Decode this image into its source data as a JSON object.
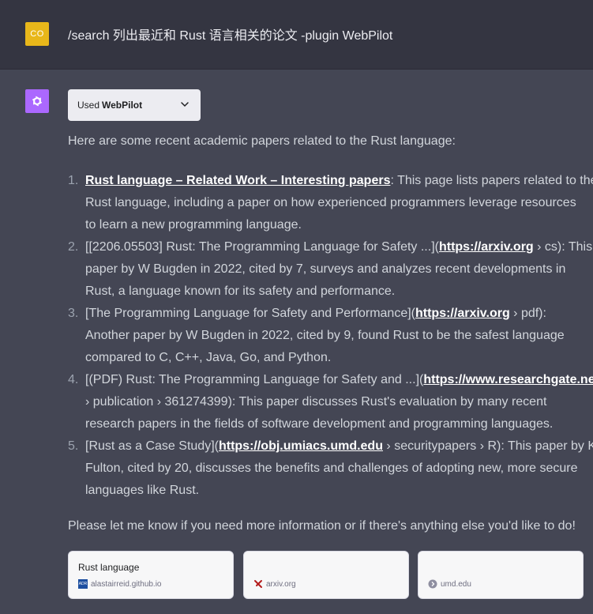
{
  "user_message": {
    "avatar_initials": "CO",
    "text": "/search 列出最近和 Rust 语言相关的论文 -plugin WebPilot"
  },
  "assistant": {
    "plugin_chip": {
      "used_label": "Used",
      "plugin_name": "WebPilot"
    },
    "intro": "Here are some recent academic papers related to the Rust language:",
    "items": [
      {
        "number": "1.",
        "link": "Rust language – Related Work – Interesting papers",
        "l1_after": ": This page lists papers related to the",
        "l2": "Rust language, including a paper on how experienced programmers leverage resources",
        "l3": "to learn a new programming language."
      },
      {
        "number": "2.",
        "l1_before": "[[2206.05503] Rust: The Programming Language for Safety ...](",
        "link": "https://arxiv.org",
        "l1_after": " › cs): This",
        "l2": "paper by W Bugden in 2022, cited by 7, surveys and analyzes recent developments in",
        "l3": "Rust, a language known for its safety and performance."
      },
      {
        "number": "3.",
        "l1_before": "[The Programming Language for Safety and Performance](",
        "link": "https://arxiv.org",
        "l1_after": " › pdf):",
        "l2": "Another paper by W Bugden in 2022, cited by 9, found Rust to be the safest language",
        "l3": "compared to C, C++, Java, Go, and Python."
      },
      {
        "number": "4.",
        "l1_before": "[(PDF) Rust: The Programming Language for Safety and ...](",
        "link": "https://www.researchgate.net",
        "l2": "› publication › 361274399): This paper discusses Rust's evaluation by many recent",
        "l3": "research papers in the fields of software development and programming languages."
      },
      {
        "number": "5.",
        "l1_before": "[Rust as a Case Study](",
        "link": "https://obj.umiacs.umd.edu",
        "l1_after": " › securitypapers › R): This paper by KR",
        "l2": "Fulton, cited by 20, discusses the benefits and challenges of adopting new, more secure",
        "l3": "languages like Rust."
      }
    ],
    "outro": "Please let me know if you need more information or if there's anything else you'd like to do!",
    "source_cards": [
      {
        "title": "Rust language",
        "domain": "alastairreid.github.io",
        "favicon_text": "ADR"
      },
      {
        "title": "",
        "domain": "arxiv.org"
      },
      {
        "title": "",
        "domain": "umd.edu"
      }
    ]
  },
  "colors": {
    "user_bg": "#343541",
    "assistant_bg": "#444654",
    "user_avatar": "#e8b71a",
    "assistant_avatar": "#ab68ff"
  }
}
